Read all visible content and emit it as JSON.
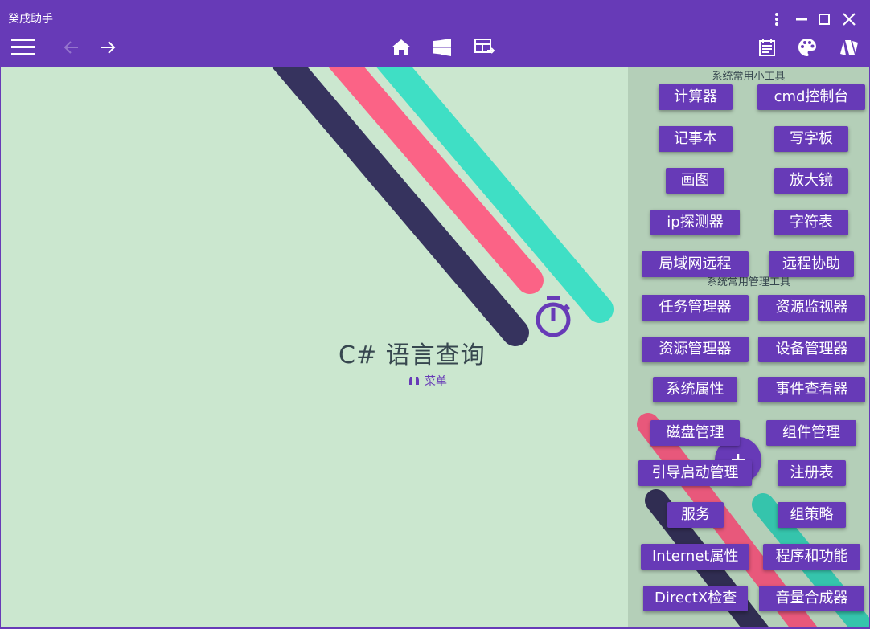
{
  "window": {
    "title": "癸戌助手"
  },
  "colors": {
    "primary": "#673ab7",
    "background": "#cbe7cf",
    "sidebar": "#b4cfb8",
    "stripe_dark": "#36335e",
    "stripe_pink": "#fb6386",
    "stripe_teal": "#3fdfc5"
  },
  "toolbar": {
    "left_icons": [
      "hamburger-menu-icon",
      "back-arrow-icon",
      "forward-arrow-icon"
    ],
    "center_icons": [
      "home-icon",
      "windows-icon",
      "layout-icon"
    ],
    "right_icons": [
      "calendar-icon",
      "palette-icon",
      "cards-icon"
    ]
  },
  "main": {
    "title": "C# 语言查询",
    "menu_label": "菜单"
  },
  "sidebar": {
    "section1_title": "系统常用小工具",
    "section2_title": "系统常用管理工具",
    "tools": [
      "计算器",
      "cmd控制台",
      "记事本",
      "写字板",
      "画图",
      "放大镜",
      "ip探测器",
      "字符表",
      "局域网远程",
      "远程协助"
    ],
    "admin_tools": [
      "任务管理器",
      "资源监视器",
      "资源管理器",
      "设备管理器",
      "系统属性",
      "事件查看器",
      "磁盘管理",
      "组件管理",
      "引导启动管理",
      "注册表",
      "服务",
      "组策略",
      "Internet属性",
      "程序和功能",
      "DirectX检查",
      "音量合成器"
    ]
  }
}
